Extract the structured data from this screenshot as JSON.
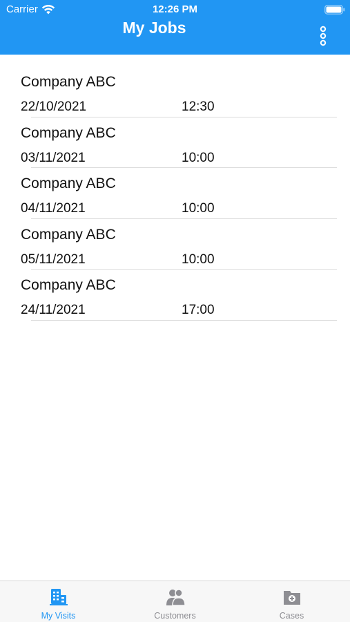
{
  "status_bar": {
    "carrier": "Carrier",
    "time": "12:26 PM"
  },
  "header": {
    "title": "My Jobs",
    "more_icon": "more-vertical-icon",
    "background": "#2196f3"
  },
  "jobs": [
    {
      "company": "Company ABC",
      "date": "22/10/2021",
      "time": "12:30"
    },
    {
      "company": "Company ABC",
      "date": "03/11/2021",
      "time": "10:00"
    },
    {
      "company": "Company ABC",
      "date": "04/11/2021",
      "time": "10:00"
    },
    {
      "company": "Company ABC",
      "date": "05/11/2021",
      "time": "10:00"
    },
    {
      "company": "Company ABC",
      "date": "24/11/2021",
      "time": "17:00"
    }
  ],
  "tabs": [
    {
      "label": "My Visits",
      "icon": "building-icon",
      "active": true
    },
    {
      "label": "Customers",
      "icon": "people-icon",
      "active": false
    },
    {
      "label": "Cases",
      "icon": "folder-plus-icon",
      "active": false
    }
  ],
  "colors": {
    "accent": "#2196f3",
    "inactive": "#8e8e93"
  }
}
